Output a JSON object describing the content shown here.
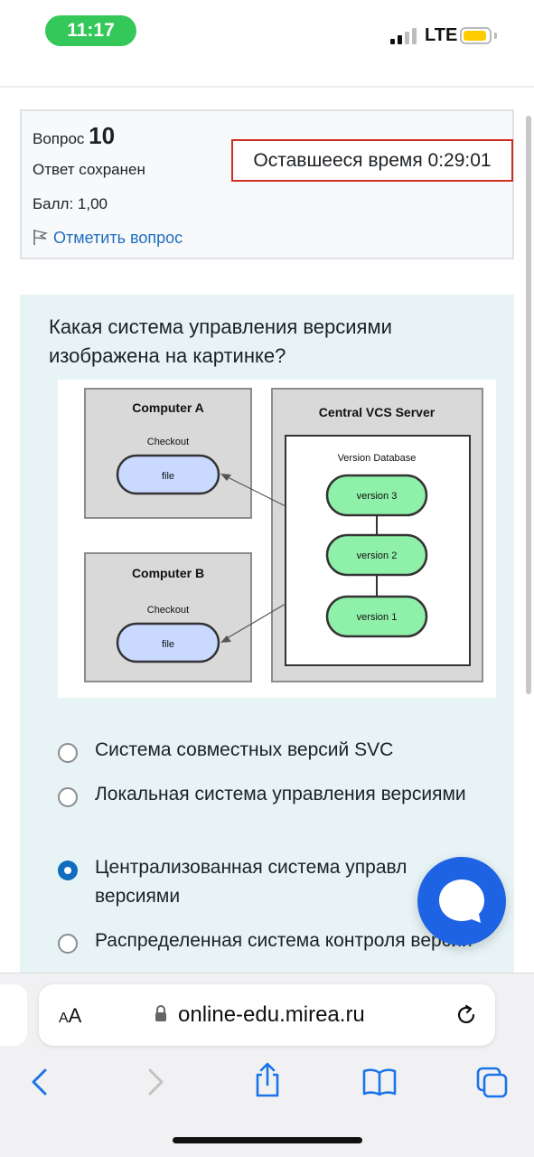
{
  "status_bar": {
    "time": "11:17",
    "network": "LTE"
  },
  "question_info": {
    "label": "Вопрос",
    "number": "10",
    "state": "Ответ сохранен",
    "grade": "Балл: 1,00",
    "flag_label": "Отметить вопрос"
  },
  "timer": {
    "text": "Оставшееся время 0:29:01"
  },
  "question": {
    "text": "Какая система управления версиями изображена на картинке?",
    "diagram": {
      "computer_a": "Computer A",
      "computer_b": "Computer B",
      "checkout": "Checkout",
      "file": "file",
      "server_title": "Central VCS Server",
      "db_title": "Version Database",
      "versions": [
        "version 3",
        "version 2",
        "version 1"
      ]
    }
  },
  "answers": [
    {
      "label": "Система совместных версий SVC",
      "selected": false
    },
    {
      "label": "Локальная система управления версиями",
      "selected": false
    },
    {
      "label": "Централизованная система управл версиями",
      "selected": true
    },
    {
      "label": "Распределенная система контроля версий",
      "selected": false
    }
  ],
  "browser": {
    "aa_label": "AA",
    "url": "online-edu.mirea.ru"
  },
  "colors": {
    "accent": "#0f6cbf",
    "timer_border": "#ca3120",
    "question_bg": "#e7f3f5",
    "time_pill": "#34c759",
    "chat_fab": "#1e63e3"
  }
}
